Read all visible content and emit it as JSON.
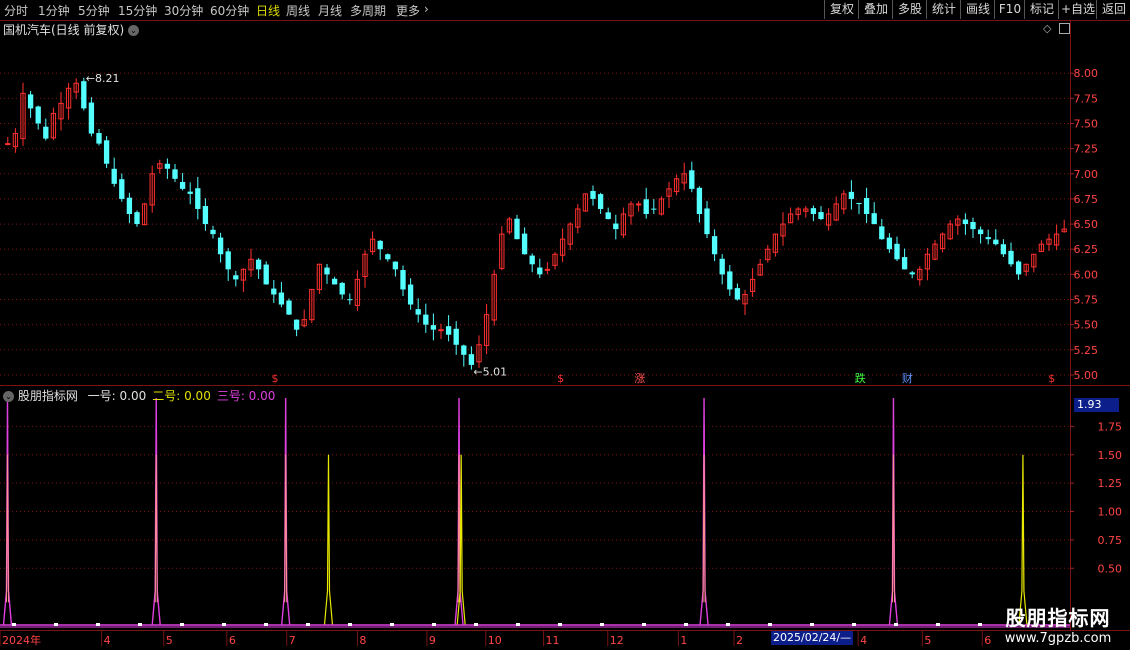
{
  "toolbar": {
    "periods": [
      "分时",
      "1分钟",
      "5分钟",
      "15分钟",
      "30分钟",
      "60分钟",
      "日线",
      "周线",
      "月线",
      "多周期",
      "更多"
    ],
    "active": "日线",
    "right_buttons": [
      "复权",
      "叠加",
      "多股",
      "统计",
      "画线",
      "F10",
      "标记",
      "+自选",
      "返回"
    ]
  },
  "main_header": {
    "title": "国机汽车(日线 前复权)"
  },
  "indicator_header": {
    "title": "股朋指标网",
    "items": [
      {
        "label": "一号: 0.00",
        "color": "#e0e0e0"
      },
      {
        "label": "二号: 0.00",
        "color": "#e0e000"
      },
      {
        "label": "三号: 0.00",
        "color": "#e040e0"
      }
    ],
    "current_value": "1.93"
  },
  "colors": {
    "up": "#ff3030",
    "down": "#54ffff",
    "grid": "#7a1414",
    "axis_text": "#ff4444",
    "magenta": "#e040e0",
    "yellow": "#e8e800"
  },
  "event_markers": [
    {
      "text": "$",
      "x": 0.257,
      "color": "#ff3030"
    },
    {
      "text": "$",
      "x": 0.524,
      "color": "#ff3030"
    },
    {
      "text": "涨",
      "x": 0.598,
      "color": "#ff5050"
    },
    {
      "text": "跌",
      "x": 0.804,
      "color": "#40ff40"
    },
    {
      "text": "财",
      "x": 0.848,
      "color": "#6090ff"
    },
    {
      "text": "$",
      "x": 0.983,
      "color": "#ff3030"
    }
  ],
  "x_axis": {
    "labels": [
      {
        "text": "2024年",
        "x": 0.0
      },
      {
        "text": "4",
        "x": 0.095
      },
      {
        "text": "5",
        "x": 0.153
      },
      {
        "text": "6",
        "x": 0.212
      },
      {
        "text": "7",
        "x": 0.268
      },
      {
        "text": "8",
        "x": 0.334
      },
      {
        "text": "9",
        "x": 0.399
      },
      {
        "text": "10",
        "x": 0.454
      },
      {
        "text": "11",
        "x": 0.508
      },
      {
        "text": "12",
        "x": 0.568
      },
      {
        "text": "1",
        "x": 0.634
      },
      {
        "text": "2",
        "x": 0.686
      },
      {
        "text": "4",
        "x": 0.802
      },
      {
        "text": "5",
        "x": 0.862
      },
      {
        "text": "6",
        "x": 0.918
      }
    ],
    "highlight_date": "2025/02/24/—"
  },
  "watermark": {
    "line1": "股朋指标网",
    "line2": "www.7gpzb.com"
  },
  "chart_data": [
    {
      "type": "candlestick",
      "title": "国机汽车(日线 前复权)",
      "ylim": [
        4.9,
        8.35
      ],
      "y_ticks": [
        5.0,
        5.25,
        5.5,
        5.75,
        6.0,
        6.25,
        6.5,
        6.75,
        7.0,
        7.25,
        7.5,
        7.75,
        8.0
      ],
      "annotations": [
        {
          "text": "8.21",
          "kind": "high"
        },
        {
          "text": "5.01",
          "kind": "low"
        }
      ],
      "close_path": [
        7.3,
        7.4,
        7.8,
        7.65,
        7.5,
        7.35,
        7.6,
        7.7,
        7.85,
        7.9,
        7.65,
        7.4,
        7.3,
        7.1,
        6.9,
        6.75,
        6.6,
        6.5,
        6.7,
        7.0,
        7.1,
        7.05,
        6.95,
        6.85,
        6.8,
        6.65,
        6.5,
        6.4,
        6.2,
        6.05,
        5.95,
        6.05,
        6.15,
        6.05,
        5.9,
        5.8,
        5.7,
        5.6,
        5.45,
        5.55,
        5.85,
        6.1,
        6.0,
        5.9,
        5.8,
        5.75,
        5.95,
        6.2,
        6.35,
        6.25,
        6.15,
        6.05,
        5.85,
        5.7,
        5.6,
        5.5,
        5.45,
        5.45,
        5.4,
        5.3,
        5.2,
        5.1,
        5.3,
        5.6,
        6.0,
        6.4,
        6.55,
        6.35,
        6.2,
        6.1,
        6.0,
        6.05,
        6.2,
        6.35,
        6.5,
        6.65,
        6.8,
        6.75,
        6.65,
        6.55,
        6.45,
        6.6,
        6.7,
        6.7,
        6.6,
        6.65,
        6.75,
        6.85,
        6.95,
        7.0,
        6.85,
        6.6,
        6.4,
        6.2,
        6.0,
        5.85,
        5.75,
        5.8,
        5.95,
        6.1,
        6.25,
        6.4,
        6.5,
        6.6,
        6.65,
        6.65,
        6.6,
        6.55,
        6.6,
        6.7,
        6.8,
        6.75,
        6.7,
        6.6,
        6.5,
        6.35,
        6.25,
        6.15,
        6.05,
        6.0,
        6.05,
        6.2,
        6.3,
        6.4,
        6.5,
        6.55,
        6.5,
        6.45,
        6.4,
        6.35,
        6.3,
        6.2,
        6.1,
        6.0,
        6.1,
        6.2,
        6.3,
        6.35,
        6.4,
        6.45
      ]
    },
    {
      "type": "line",
      "title": "股朋指标网",
      "ylim": [
        0,
        2.0
      ],
      "y_ticks": [
        0.5,
        0.75,
        1.0,
        1.25,
        1.5,
        1.75
      ],
      "series": [
        {
          "name": "一号",
          "color": "#e0e0e0",
          "spikes": [],
          "baseline": 0
        },
        {
          "name": "二号",
          "color": "#e8e800",
          "spikes": [
            {
              "x": 0.307,
              "y": 1.5
            },
            {
              "x": 0.431,
              "y": 1.5
            },
            {
              "x": 0.956,
              "y": 1.5
            }
          ],
          "baseline": 0
        },
        {
          "name": "三号",
          "color": "#e040e0",
          "spikes": [
            {
              "x": 0.007,
              "y": 2.0
            },
            {
              "x": 0.146,
              "y": 2.0
            },
            {
              "x": 0.267,
              "y": 2.0
            },
            {
              "x": 0.429,
              "y": 2.0
            },
            {
              "x": 0.658,
              "y": 2.0
            },
            {
              "x": 0.835,
              "y": 2.0
            }
          ],
          "baseline": 0
        }
      ]
    }
  ]
}
